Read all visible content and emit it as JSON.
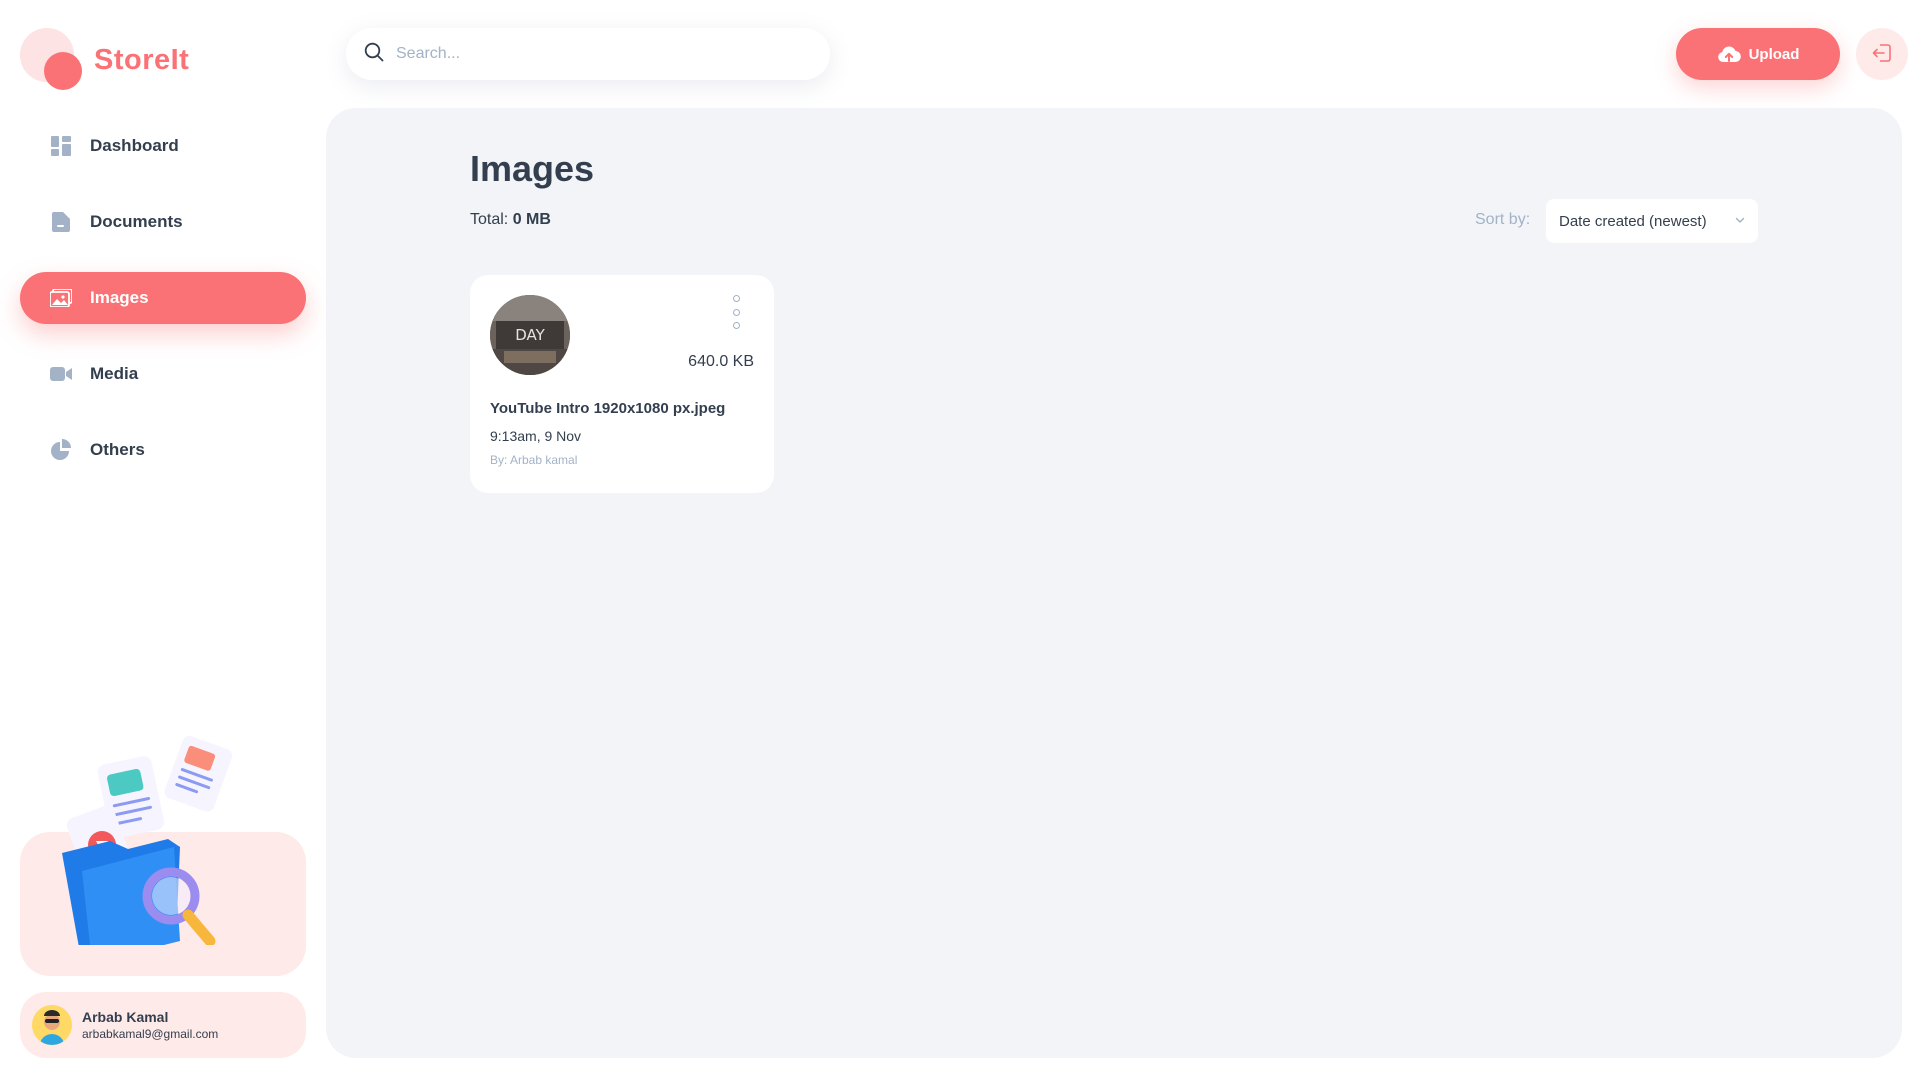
{
  "app": {
    "name": "StoreIt"
  },
  "colors": {
    "brand": "#FA7275",
    "brand_light": "#FFEAEA",
    "text": "#333F4E",
    "muted": "#A3B2C7",
    "main_bg": "#F2F4F8"
  },
  "sidebar": {
    "items": [
      {
        "label": "Dashboard",
        "icon": "dashboard-icon"
      },
      {
        "label": "Documents",
        "icon": "documents-icon"
      },
      {
        "label": "Images",
        "icon": "images-icon",
        "active": true
      },
      {
        "label": "Media",
        "icon": "media-icon"
      },
      {
        "label": "Others",
        "icon": "others-icon"
      }
    ],
    "user": {
      "name": "Arbab Kamal",
      "email": "arbabkamal9@gmail.com"
    }
  },
  "header": {
    "search": {
      "placeholder": "Search..."
    },
    "upload_label": "Upload"
  },
  "main": {
    "title": "Images",
    "total_label": "Total:",
    "total_value": "0 MB",
    "sort_label": "Sort by:",
    "sort_value": "Date created (newest)",
    "files": [
      {
        "name": "YouTube Intro 1920x1080 px.jpeg",
        "size": "640.0 KB",
        "date": "9:13am, 9 Nov",
        "owner": "By: Arbab kamal",
        "thumb_text": "DAY"
      }
    ]
  }
}
